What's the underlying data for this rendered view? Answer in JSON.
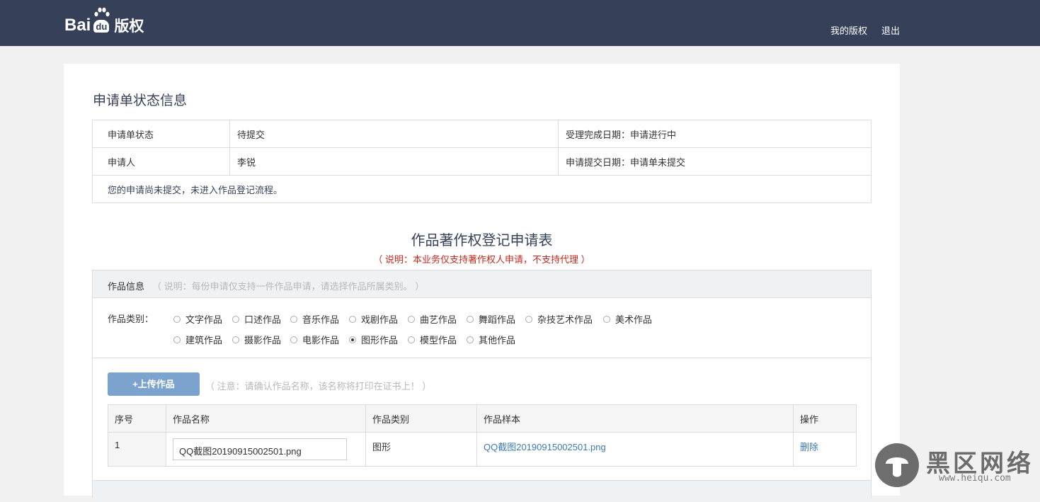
{
  "header": {
    "logo": {
      "part1": "Bai",
      "part2": "du",
      "part3": "版权"
    },
    "nav": {
      "my_copyright": "我的版权",
      "logout": "退出"
    }
  },
  "status_section": {
    "title": "申请单状态信息",
    "rows": [
      {
        "label": "申请单状态",
        "value": "待提交",
        "right": "受理完成日期：申请进行中"
      },
      {
        "label": "申请人",
        "value": "李锐",
        "right": "申请提交日期：申请单未提交"
      }
    ],
    "note": "您的申请尚未提交，未进入作品登记流程。"
  },
  "form": {
    "title": "作品著作权登记申请表",
    "subtitle": "（ 说明：本业务仅支持著作权人申请，不支持代理 ）",
    "info_label": "作品信息",
    "info_hint": "（ 说明：每份申请仅支持一件作品申请，请选择作品所属类别。 ）",
    "category_label": "作品类别：",
    "categories": [
      "文字作品",
      "口述作品",
      "音乐作品",
      "戏剧作品",
      "曲艺作品",
      "舞蹈作品",
      "杂技艺术作品",
      "美术作品",
      "建筑作品",
      "摄影作品",
      "电影作品",
      "图形作品",
      "模型作品",
      "其他作品"
    ],
    "selected_category": "图形作品",
    "upload_button": "+上传作品",
    "upload_hint": "（ 注意：请确认作品名称，该名称将打印在证书上！ ）",
    "table": {
      "headers": [
        "序号",
        "作品名称",
        "作品类别",
        "作品样本",
        "操作"
      ],
      "rows": [
        {
          "index": "1",
          "name": "QQ截图20190915002501.png",
          "category": "图形",
          "sample": "QQ截图20190915002501.png",
          "action": "删除"
        }
      ]
    }
  },
  "watermark": {
    "big": "黑区网络",
    "small": "www.heiqu.com"
  }
}
